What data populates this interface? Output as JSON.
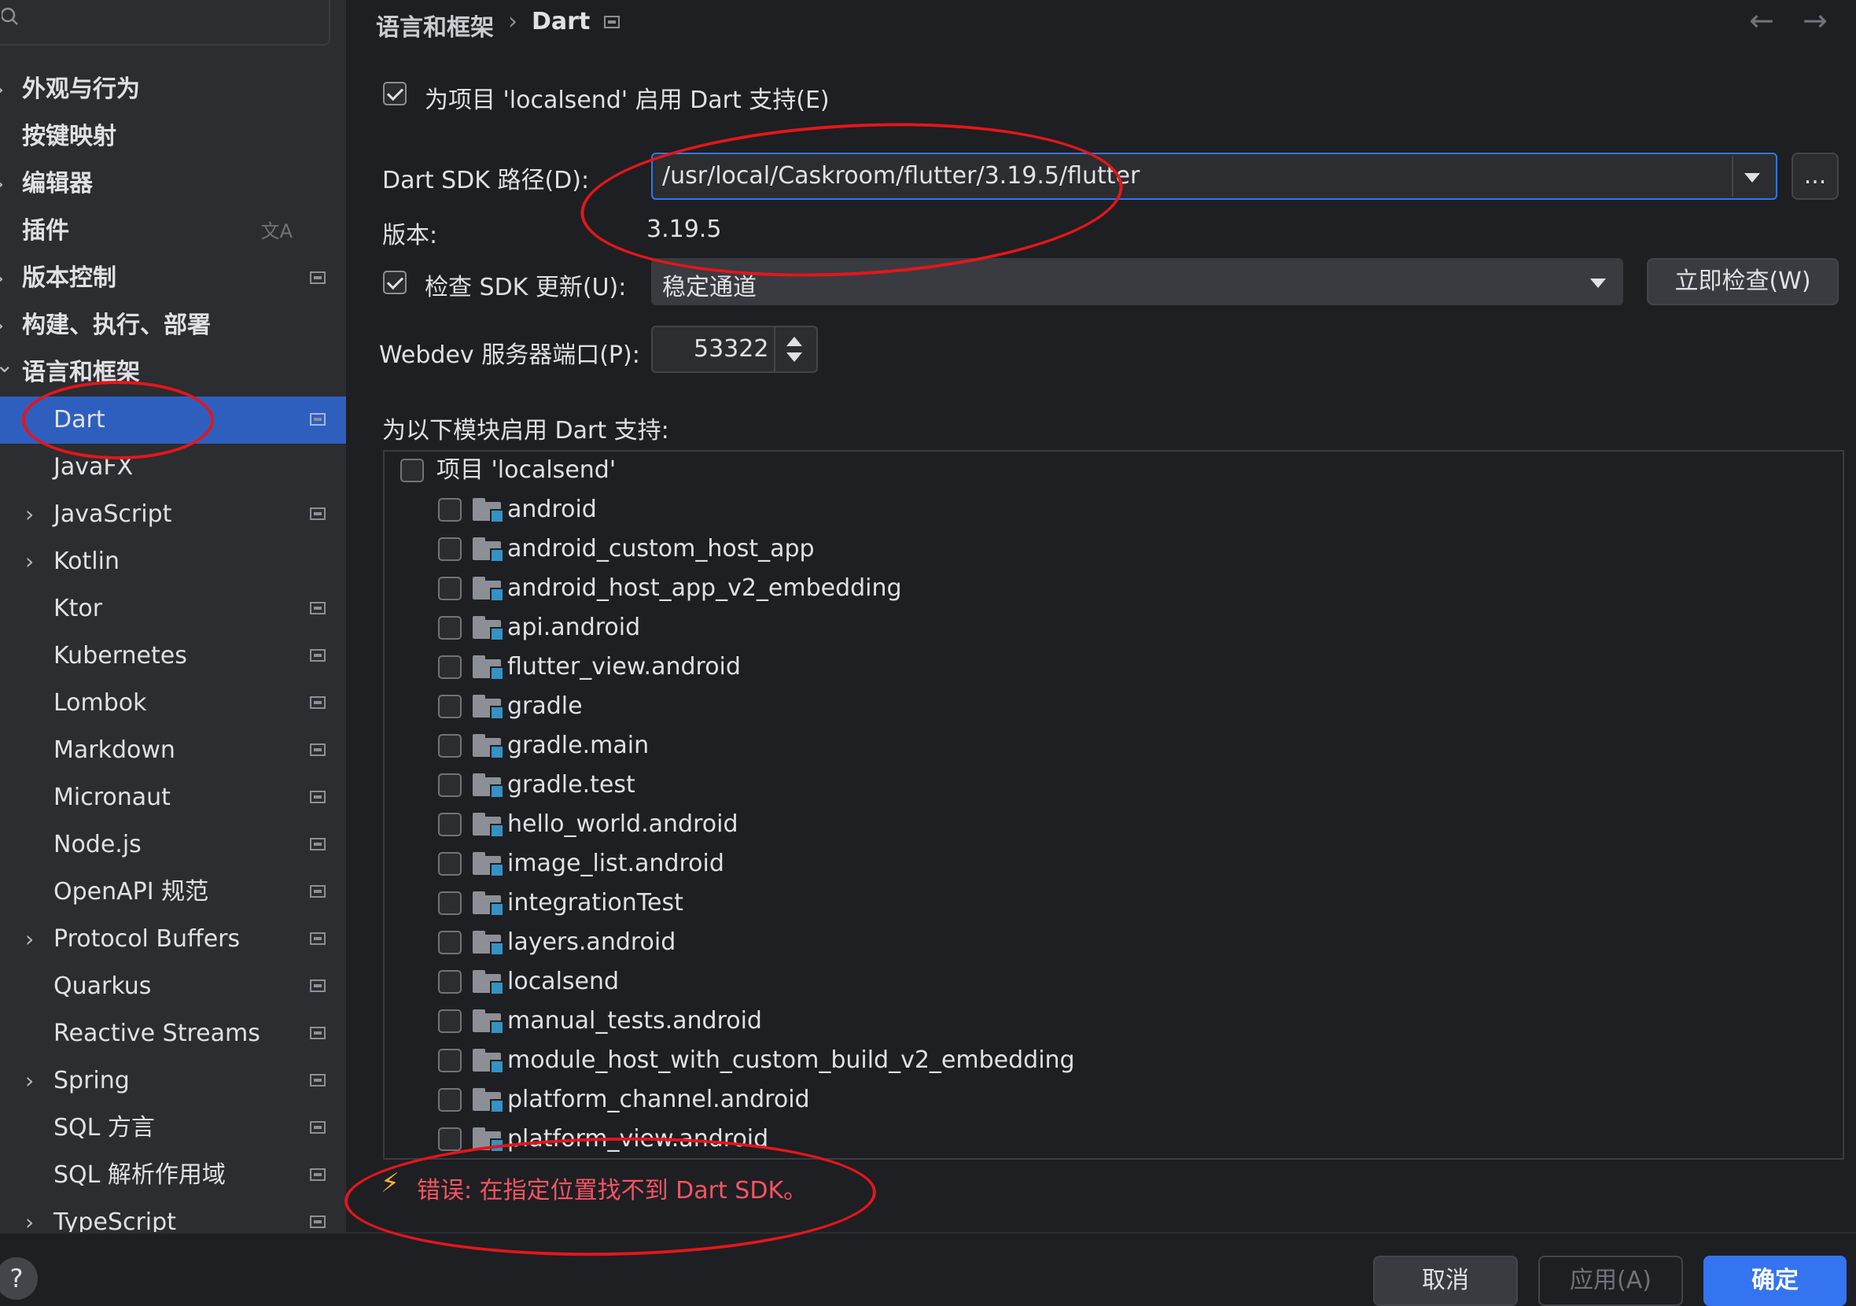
{
  "sidebar": {
    "search_icon": "search-icon",
    "items": [
      {
        "label": "外观与行为",
        "expand": "collapsed",
        "indent": 0
      },
      {
        "label": "按键映射",
        "expand": "none",
        "indent": 0
      },
      {
        "label": "编辑器",
        "expand": "collapsed",
        "indent": 0
      },
      {
        "label": "插件",
        "expand": "none",
        "indent": 0,
        "icon": "translate-icon"
      },
      {
        "label": "版本控制",
        "expand": "collapsed",
        "indent": 0,
        "icon": "project-scope-icon"
      },
      {
        "label": "构建、执行、部署",
        "expand": "collapsed",
        "indent": 0
      },
      {
        "label": "语言和框架",
        "expand": "expanded",
        "indent": 0
      },
      {
        "label": "Dart",
        "expand": "none",
        "indent": 1,
        "icon": "project-scope-icon",
        "selected": true
      },
      {
        "label": "JavaFX",
        "expand": "none",
        "indent": 1
      },
      {
        "label": "JavaScript",
        "expand": "collapsed",
        "indent": 1,
        "icon": "project-scope-icon"
      },
      {
        "label": "Kotlin",
        "expand": "collapsed",
        "indent": 1
      },
      {
        "label": "Ktor",
        "expand": "none",
        "indent": 1,
        "icon": "project-scope-icon"
      },
      {
        "label": "Kubernetes",
        "expand": "none",
        "indent": 1,
        "icon": "project-scope-icon"
      },
      {
        "label": "Lombok",
        "expand": "none",
        "indent": 1,
        "icon": "project-scope-icon"
      },
      {
        "label": "Markdown",
        "expand": "none",
        "indent": 1,
        "icon": "project-scope-icon"
      },
      {
        "label": "Micronaut",
        "expand": "none",
        "indent": 1,
        "icon": "project-scope-icon"
      },
      {
        "label": "Node.js",
        "expand": "none",
        "indent": 1,
        "icon": "project-scope-icon"
      },
      {
        "label": "OpenAPI 规范",
        "expand": "none",
        "indent": 1,
        "icon": "project-scope-icon"
      },
      {
        "label": "Protocol Buffers",
        "expand": "collapsed",
        "indent": 1,
        "icon": "project-scope-icon"
      },
      {
        "label": "Quarkus",
        "expand": "none",
        "indent": 1,
        "icon": "project-scope-icon"
      },
      {
        "label": "Reactive Streams",
        "expand": "none",
        "indent": 1,
        "icon": "project-scope-icon"
      },
      {
        "label": "Spring",
        "expand": "collapsed",
        "indent": 1,
        "icon": "project-scope-icon"
      },
      {
        "label": "SQL 方言",
        "expand": "none",
        "indent": 1,
        "icon": "project-scope-icon"
      },
      {
        "label": "SQL 解析作用域",
        "expand": "none",
        "indent": 1,
        "icon": "project-scope-icon"
      },
      {
        "label": "TypeScript",
        "expand": "collapsed",
        "indent": 1,
        "icon": "project-scope-icon"
      }
    ]
  },
  "header": {
    "breadcrumb_parent": "语言和框架",
    "breadcrumb_sep": "›",
    "breadcrumb_current": "Dart",
    "back_icon": "←",
    "forward_icon": "→"
  },
  "settings": {
    "enable_dart_label": "为项目 'localsend' 启用 Dart 支持(E)",
    "enable_dart_checked": true,
    "sdk_path_label": "Dart SDK 路径(D):",
    "sdk_path_value": "/usr/local/Caskroom/flutter/3.19.5/flutter",
    "browse_label": "...",
    "version_label": "版本:",
    "version_value": "3.19.5",
    "check_updates_label": "检查 SDK 更新(U):",
    "check_updates_checked": true,
    "channel_value": "稳定通道",
    "check_now_label": "立即检查(W)",
    "webdev_port_label": "Webdev 服务器端口(P):",
    "webdev_port_value": "53322",
    "modules_label": "为以下模块启用 Dart 支持:"
  },
  "modules": {
    "root": "项目 'localsend'",
    "items": [
      "android",
      "android_custom_host_app",
      "android_host_app_v2_embedding",
      "api.android",
      "flutter_view.android",
      "gradle",
      "gradle.main",
      "gradle.test",
      "hello_world.android",
      "image_list.android",
      "integrationTest",
      "layers.android",
      "localsend",
      "manual_tests.android",
      "module_host_with_custom_build_v2_embedding",
      "platform_channel.android",
      "platform_view.android"
    ]
  },
  "error": {
    "icon": "⚡",
    "text": "错误: 在指定位置找不到 Dart SDK。"
  },
  "footer": {
    "help_label": "?",
    "cancel_label": "取消",
    "apply_label": "应用(A)",
    "ok_label": "确定"
  },
  "colors": {
    "accent": "#3574f0",
    "selection": "#2e5fbf",
    "error": "#f75464",
    "annotation": "#e3161b"
  }
}
